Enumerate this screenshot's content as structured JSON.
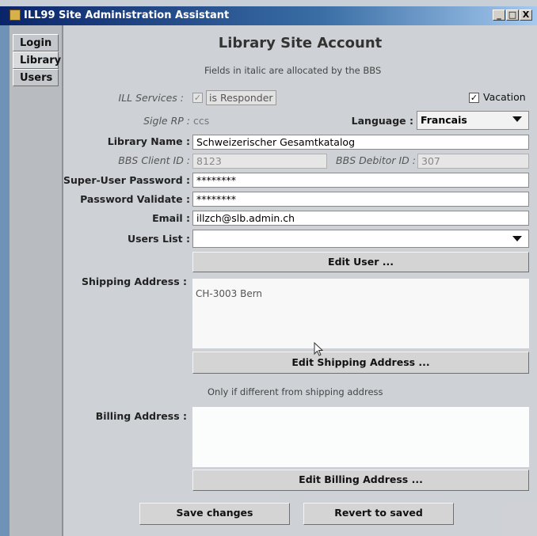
{
  "window": {
    "title": "ILL99 Site Administration Assistant",
    "minimize": "_",
    "maximize": "□",
    "close": "X"
  },
  "tabs": [
    {
      "label": "Login"
    },
    {
      "label": "Library"
    },
    {
      "label": "Users"
    }
  ],
  "heading": "Library Site Account",
  "note_italic": "Fields in italic are allocated by the BBS",
  "ill_services": {
    "label": "ILL Services :",
    "checkbox": "✓",
    "responder": "is Responder"
  },
  "vacation": {
    "label": "Vacation",
    "checkbox": "✓"
  },
  "sigle": {
    "label": "Sigle RP :",
    "value": "ccs"
  },
  "language": {
    "label": "Language :",
    "value": "Francais"
  },
  "library_name": {
    "label": "Library Name :",
    "value": "Schweizerischer Gesamtkatalog"
  },
  "bbs_client": {
    "label": "BBS Client ID :",
    "value": "8123"
  },
  "bbs_debitor": {
    "label": "BBS Debitor ID :",
    "value": "307"
  },
  "su_password": {
    "label": "Super-User Password :",
    "value": "********"
  },
  "pw_validate": {
    "label": "Password Validate :",
    "value": "********"
  },
  "email": {
    "label": "Email :",
    "value": "illzch@slb.admin.ch"
  },
  "users_list": {
    "label": "Users List :",
    "value": ""
  },
  "edit_user": "Edit User ...",
  "shipping": {
    "label": "Shipping Address :",
    "value": "CH-3003 Bern"
  },
  "edit_shipping": "Edit Shipping Address ...",
  "only_if": "Only if different from shipping address",
  "billing": {
    "label": "Billing Address :",
    "value": ""
  },
  "edit_billing": "Edit Billing Address ...",
  "save": "Save changes",
  "revert": "Revert to saved"
}
